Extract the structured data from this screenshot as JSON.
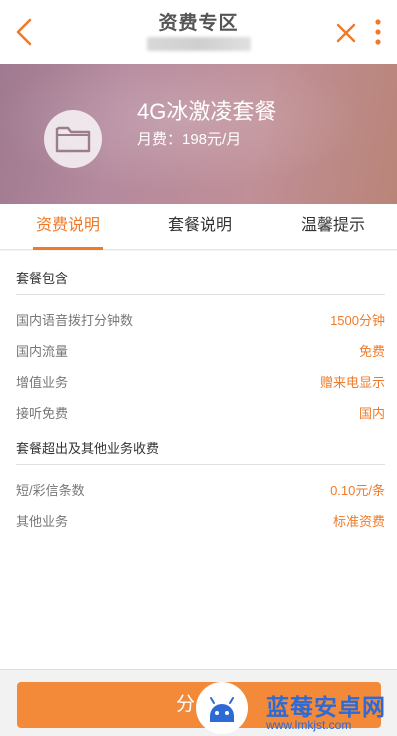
{
  "header": {
    "title": "资费专区",
    "back_icon": "chevron-left-icon",
    "close_icon": "close-icon",
    "more_icon": "more-vertical-icon",
    "accent_color": "#f07a2a"
  },
  "banner": {
    "icon": "folder-icon",
    "plan_name": "4G冰激凌套餐",
    "monthly_fee": "月费：198元/月"
  },
  "tabs": [
    {
      "label": "资费说明",
      "active": true
    },
    {
      "label": "套餐说明",
      "active": false
    },
    {
      "label": "温馨提示",
      "active": false
    }
  ],
  "sections": [
    {
      "title": "套餐包含",
      "rows": [
        {
          "label": "国内语音拨打分钟数",
          "value": "1500分钟"
        },
        {
          "label": "国内流量",
          "value": "免费"
        },
        {
          "label": "增值业务",
          "value": "赠来电显示"
        },
        {
          "label": "接听免费",
          "value": "国内"
        }
      ]
    },
    {
      "title": "套餐超出及其他业务收费",
      "rows": [
        {
          "label": "短/彩信条数",
          "value": "0.10元/条"
        },
        {
          "label": "其他业务",
          "value": "标准资费"
        }
      ]
    }
  ],
  "footer": {
    "share_label": "分享"
  },
  "watermark": {
    "icon": "android-robot-icon",
    "brand": "蓝莓安卓网",
    "url": "www.lmkjst.com"
  }
}
